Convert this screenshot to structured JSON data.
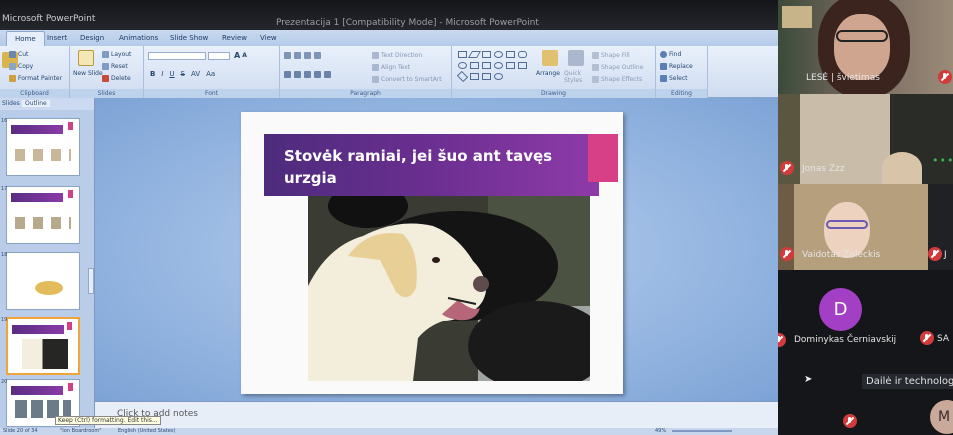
{
  "window": {
    "app_title": "Microsoft PowerPoint",
    "doc_title": "Prezentacija 1 [Compatibility Mode] - Microsoft PowerPoint"
  },
  "ribbon": {
    "tabs": [
      "Home",
      "Insert",
      "Design",
      "Animations",
      "Slide Show",
      "Review",
      "View"
    ],
    "active_tab": "Home",
    "clipboard": {
      "cut": "Cut",
      "copy": "Copy",
      "format_painter": "Format Painter",
      "label": "Clipboard"
    },
    "slides": {
      "new_slide": "New Slide",
      "layout": "Layout",
      "reset": "Reset",
      "delete": "Delete",
      "label": "Slides"
    },
    "font": {
      "label": "Font"
    },
    "paragraph": {
      "text_direction": "Text Direction",
      "align_text": "Align Text",
      "convert": "Convert to SmartArt",
      "label": "Paragraph"
    },
    "drawing": {
      "arrange": "Arrange",
      "quick_styles": "Quick Styles",
      "shape_fill": "Shape Fill",
      "shape_outline": "Shape Outline",
      "shape_effects": "Shape Effects",
      "label": "Drawing"
    },
    "editing": {
      "find": "Find",
      "replace": "Replace",
      "select": "Select",
      "label": "Editing"
    }
  },
  "left_pane": {
    "tabs": [
      "Slides",
      "Outline"
    ],
    "slide_numbers": [
      "16",
      "17",
      "18",
      "19",
      "20"
    ],
    "selected_index": 3
  },
  "slide": {
    "title": "Stovėk ramiai, jei šuo ant tavęs urzgia",
    "colors": {
      "banner": "#6b2f91",
      "accent": "#d73f87"
    }
  },
  "notes": {
    "placeholder": "Click to add notes"
  },
  "status": {
    "slide_info": "Slide 20 of 34",
    "theme": "\"Ion Boardroom\"",
    "language": "English (United States)",
    "zoom": "49%",
    "hint": "Keep (Ctrl) formatting. Edit this..."
  },
  "call": {
    "participants": [
      {
        "name": "LESĖ | švietimas",
        "muted": false
      },
      {
        "name": "Jonas Zzz",
        "muted": true
      },
      {
        "name": "Vaidotas Zaleckis",
        "muted": true
      },
      {
        "name": "Dominykas Černiavskij",
        "muted": true,
        "avatar_letter": "D"
      }
    ],
    "edge_labels": [
      "SA",
      "J"
    ],
    "tooltip": "Dailė ir technologijos",
    "bottom_avatar_letter": "M"
  }
}
